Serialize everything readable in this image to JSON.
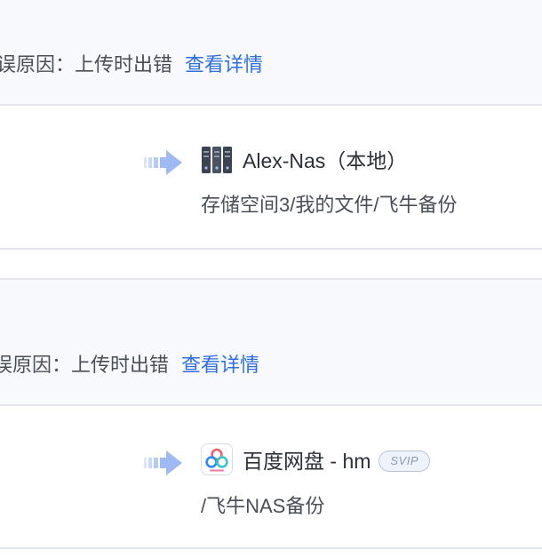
{
  "tasks": [
    {
      "error": {
        "label": "误原因：上传时出错",
        "link": "查看详情"
      },
      "destination": {
        "name": "Alex-Nas（本地）",
        "path": "存储空间3/我的文件/飞牛备份",
        "icon": "nas-server-icon"
      }
    },
    {
      "error": {
        "label": "误原因：上传时出错",
        "link": "查看详情"
      },
      "destination": {
        "name": "百度网盘 - hm",
        "badge": "SVIP",
        "path": "/飞牛NAS备份",
        "icon": "baidu-netdisk-icon"
      }
    }
  ],
  "colors": {
    "link": "#2f6fdd",
    "text": "#2b2f36",
    "secondary_text": "#4a4f57",
    "arrow": "#9fb9f2",
    "divider": "#e1e6ee",
    "header_background": "#f7f9fc"
  }
}
